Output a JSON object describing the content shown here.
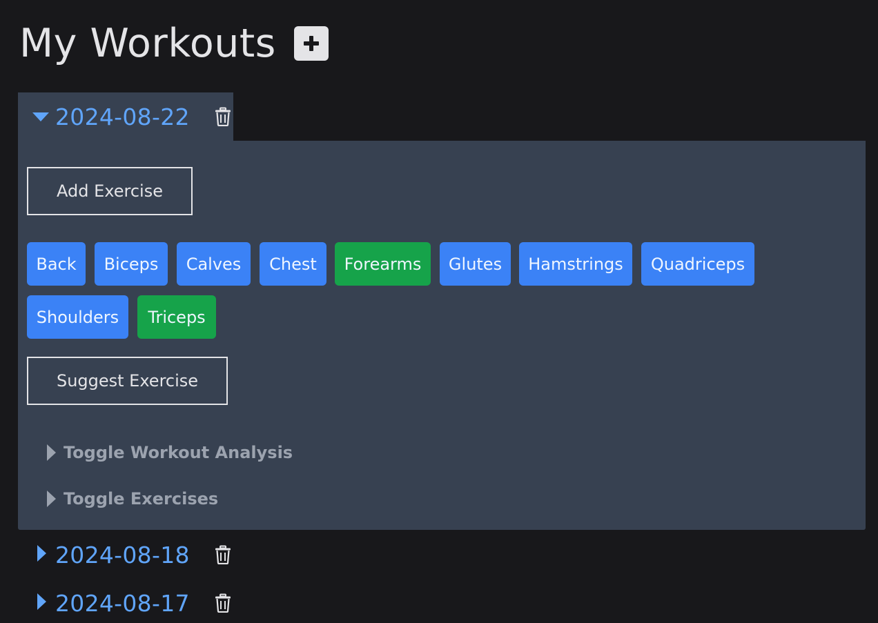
{
  "header": {
    "title": "My Workouts",
    "add_icon": "plus-icon"
  },
  "workouts": [
    {
      "date": "2024-08-22",
      "expanded": true,
      "add_exercise_label": "Add Exercise",
      "muscle_groups": [
        {
          "label": "Back",
          "selected": false
        },
        {
          "label": "Biceps",
          "selected": false
        },
        {
          "label": "Calves",
          "selected": false
        },
        {
          "label": "Chest",
          "selected": false
        },
        {
          "label": "Forearms",
          "selected": true
        },
        {
          "label": "Glutes",
          "selected": false
        },
        {
          "label": "Hamstrings",
          "selected": false
        },
        {
          "label": "Quadriceps",
          "selected": false
        },
        {
          "label": "Shoulders",
          "selected": false
        },
        {
          "label": "Triceps",
          "selected": true
        }
      ],
      "suggest_exercise_label": "Suggest Exercise",
      "toggles": [
        {
          "label": "Toggle Workout Analysis"
        },
        {
          "label": "Toggle Exercises"
        }
      ]
    },
    {
      "date": "2024-08-18",
      "expanded": false
    },
    {
      "date": "2024-08-17",
      "expanded": false
    }
  ],
  "colors": {
    "background": "#18181b",
    "panel": "#374151",
    "link": "#60a5fa",
    "tag_default": "#3b82f6",
    "tag_selected": "#16a34a",
    "muted_text": "#9ca3af"
  },
  "icons": {
    "delete": "trash-icon",
    "expanded_caret": "caret-down-icon",
    "collapsed_caret": "caret-right-icon"
  }
}
